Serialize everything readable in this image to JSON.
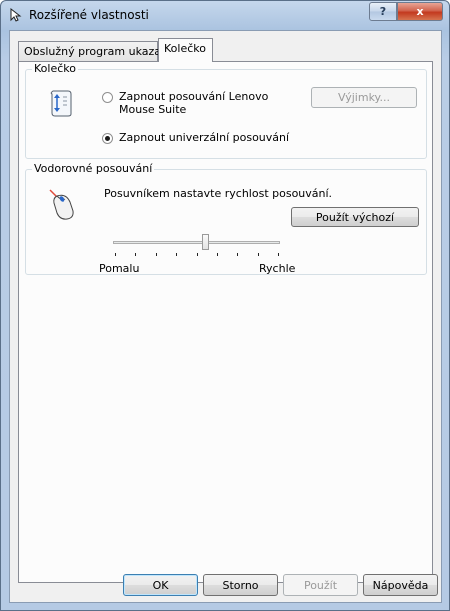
{
  "window": {
    "title": "Rozšířené vlastnosti",
    "help_symbol": "?",
    "close_symbol": "x"
  },
  "tabs": [
    {
      "label": "Obslužný program ukazatele",
      "selected": false
    },
    {
      "label": "Kolečko",
      "selected": true
    }
  ],
  "wheel_group": {
    "title": "Kolečko",
    "icon": "scroll-wheel-icon",
    "options": [
      {
        "label": "Zapnout posouvání Lenovo Mouse Suite",
        "checked": false
      },
      {
        "label": "Zapnout univerzální posouvání",
        "checked": true
      }
    ],
    "exceptions_button": "Výjimky..."
  },
  "horizontal_group": {
    "title": "Vodorovné posouvání",
    "icon": "mouse-icon",
    "instruction": "Posuvníkem nastavte rychlost posouvání.",
    "slider": {
      "min_label": "Pomalu",
      "max_label": "Rychle",
      "value": 0.55,
      "ticks": 9
    },
    "default_button": "Použít výchozí"
  },
  "footer": {
    "ok": "OK",
    "cancel": "Storno",
    "apply": "Použít",
    "help": "Nápověda"
  }
}
